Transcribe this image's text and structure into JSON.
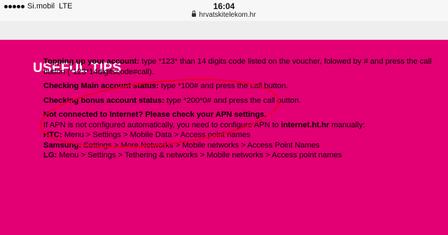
{
  "status_bar": {
    "carrier": "Si.mobil",
    "network": "LTE",
    "time": "16:04",
    "url": "hrvatskitelekom.hr"
  },
  "page": {
    "title": "USEFUL TIPS",
    "tips": {
      "topup_label": "Topping up your account:",
      "topup_text": " type *123* than 14 digits code listed on the voucher, folowed by # and press the call button (*123*14digitscode#call).",
      "main_label": "Checking Main account status:",
      "main_text": " type *100# and press the call button.",
      "bonus_label": "Checking bonus account status:",
      "bonus_text": " type *200*0# and press the call button.",
      "apn_heading": "Not connected to Internet? Please check your APN settings.",
      "apn_text_pre": "If APN is not configured automatically, you need to configure APN to ",
      "apn_value": "internet.ht.hr",
      "apn_text_post": " manually:",
      "htc_label": "HTC:",
      "htc_text": " Menu > Settings > Mobile Data > Access point names",
      "samsung_label": "Samsung:",
      "samsung_text": " Settings > More Networks > Mobile networks > Access Point Names",
      "lg_label": "LG:",
      "lg_text": " Menu > Settings > Tethering & networks > Mobile networks > Access point names"
    }
  },
  "colors": {
    "brand_magenta": "#e20074",
    "annotation_red": "#e8001c"
  }
}
